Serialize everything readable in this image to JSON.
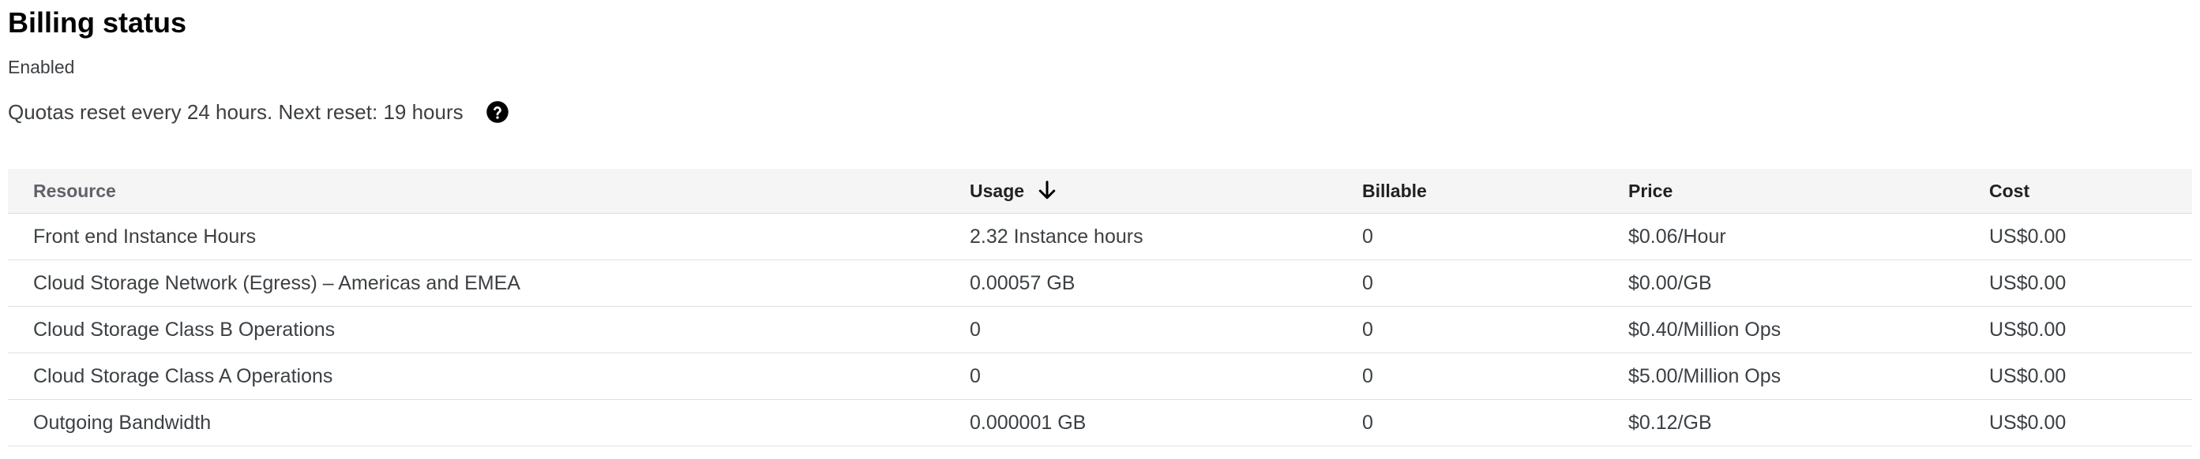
{
  "billing": {
    "title": "Billing status",
    "status": "Enabled",
    "quota_text": "Quotas reset every 24 hours. Next reset: 19 hours"
  },
  "icons": {
    "help": "help-circle-icon",
    "sort": "arrow-down-icon"
  },
  "table": {
    "headers": {
      "resource": "Resource",
      "usage": "Usage",
      "billable": "Billable",
      "price": "Price",
      "cost": "Cost"
    },
    "sort": {
      "column": "usage",
      "direction": "descending"
    },
    "rows": [
      {
        "resource": "Front end Instance Hours",
        "usage": "2.32 Instance hours",
        "billable": "0",
        "price": "$0.06/Hour",
        "cost": "US$0.00"
      },
      {
        "resource": "Cloud Storage Network (Egress) – Americas and EMEA",
        "usage": "0.00057 GB",
        "billable": "0",
        "price": "$0.00/GB",
        "cost": "US$0.00"
      },
      {
        "resource": "Cloud Storage Class B Operations",
        "usage": "0",
        "billable": "0",
        "price": "$0.40/Million Ops",
        "cost": "US$0.00"
      },
      {
        "resource": "Cloud Storage Class A Operations",
        "usage": "0",
        "billable": "0",
        "price": "$5.00/Million Ops",
        "cost": "US$0.00"
      },
      {
        "resource": "Outgoing Bandwidth",
        "usage": "0.000001 GB",
        "billable": "0",
        "price": "$0.12/GB",
        "cost": "US$0.00"
      }
    ]
  },
  "colors": {
    "header_background": "#f5f5f5",
    "divider": "#e0e0e0",
    "text": "#3c4043"
  }
}
